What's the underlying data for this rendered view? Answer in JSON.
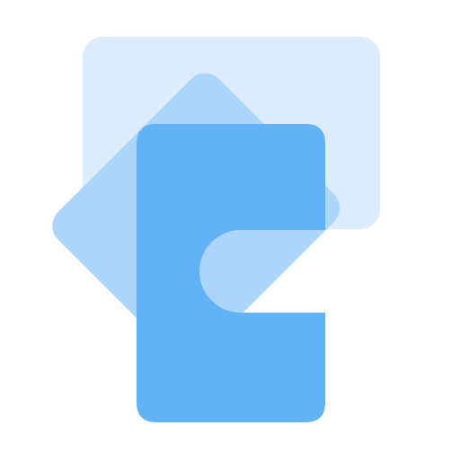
{
  "logo": {
    "icon": "layered-cards-logo",
    "colors": {
      "background": "#ffffff",
      "back_card": "#dcecfc",
      "middle_card": "#acd5fa",
      "front_card": "#62b3f5"
    }
  }
}
